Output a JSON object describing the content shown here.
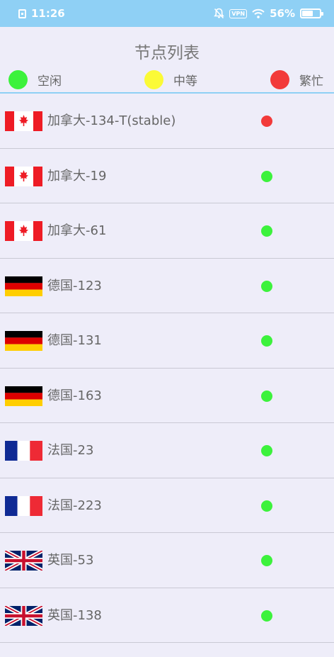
{
  "status_bar": {
    "time": "11:26",
    "vpn": "VPN",
    "battery": "56%",
    "battery_level": 0.56
  },
  "header": {
    "title": "节点列表",
    "legend": [
      {
        "label": "空闲",
        "color": "#3cf23c"
      },
      {
        "label": "中等",
        "color": "#fbfa36"
      },
      {
        "label": "繁忙",
        "color": "#f23a3a"
      }
    ]
  },
  "status_colors": {
    "green": "#3cf23c",
    "red": "#f23a3a"
  },
  "nodes": [
    {
      "name": "加拿大-134-T(stable)",
      "flag": "canada-flag-icon",
      "status": "red"
    },
    {
      "name": "加拿大-19",
      "flag": "canada-flag-icon",
      "status": "green"
    },
    {
      "name": "加拿大-61",
      "flag": "canada-flag-icon",
      "status": "green"
    },
    {
      "name": "德国-123",
      "flag": "germany-flag-icon",
      "status": "green"
    },
    {
      "name": "德国-131",
      "flag": "germany-flag-icon",
      "status": "green"
    },
    {
      "name": "德国-163",
      "flag": "germany-flag-icon",
      "status": "green"
    },
    {
      "name": "法国-23",
      "flag": "france-flag-icon",
      "status": "green"
    },
    {
      "name": "法国-223",
      "flag": "france-flag-icon",
      "status": "green"
    },
    {
      "name": "英国-53",
      "flag": "uk-flag-icon",
      "status": "green"
    },
    {
      "name": "英国-138",
      "flag": "uk-flag-icon",
      "status": "green"
    }
  ]
}
